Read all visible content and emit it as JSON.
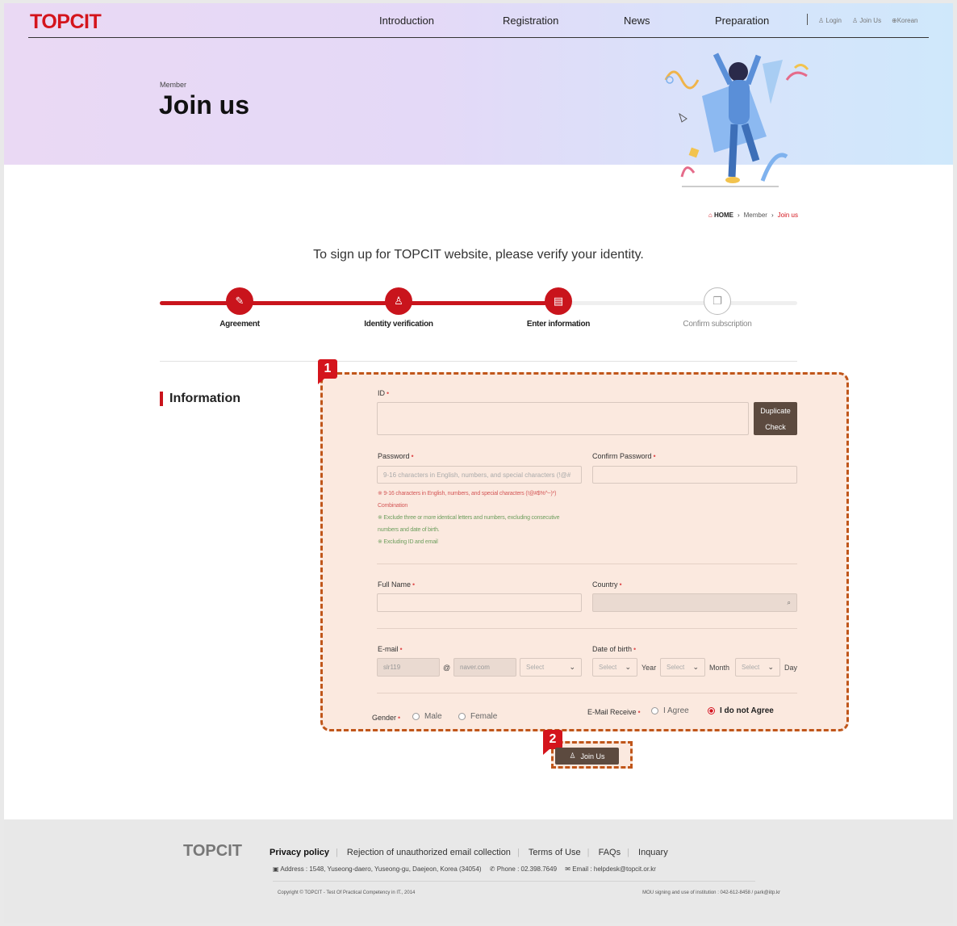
{
  "header": {
    "logo": "TOPCIT",
    "nav": [
      "Introduction",
      "Registration",
      "News",
      "Preparation"
    ],
    "util": {
      "login": "Login",
      "join": "Join Us",
      "lang": "Korean"
    },
    "member_label": "Member",
    "title": "Join us"
  },
  "breadcrumb": {
    "home": "HOME",
    "member": "Member",
    "current": "Join us"
  },
  "intro": "To sign up for TOPCIT website, please verify your identity.",
  "steps": [
    {
      "label": "Agreement",
      "icon": "pencil-icon",
      "active": true
    },
    {
      "label": "Identity verification",
      "icon": "user-icon",
      "active": true
    },
    {
      "label": "Enter information",
      "icon": "document-icon",
      "active": true
    },
    {
      "label": "Confirm subscription",
      "icon": "clipboard-icon",
      "active": false
    }
  ],
  "section_title": "Information",
  "badges": {
    "form": "1",
    "join": "2"
  },
  "form": {
    "id_label": "ID",
    "duplicate_check_line1": "Duplicate",
    "duplicate_check_line2": "Check",
    "password_label": "Password",
    "password_placeholder": "9-16 characters in English, numbers, and special characters (!@#",
    "confirm_password_label": "Confirm Password",
    "hint_1a": "※ 9-16 characters in English, numbers, and special characters (!@#$%^~)*)",
    "hint_1b": "Combination",
    "hint_2a": "※ Exclude three or more identical letters and numbers, excluding consecutive",
    "hint_2b": "numbers and date of birth.",
    "hint_3": "※ Excluding ID and email",
    "fullname_label": "Full Name",
    "country_label": "Country",
    "email_label": "E-mail",
    "email_user": "slr119",
    "email_at": "@",
    "email_domain": "naver.com",
    "email_select": "Select",
    "dob_label": "Date of birth",
    "year_select": "Select",
    "year_unit": "Year",
    "month_select": "Select",
    "month_unit": "Month",
    "day_select": "Select",
    "day_unit": "Day",
    "gender_label": "Gender",
    "gender_male": "Male",
    "gender_female": "Female",
    "email_receive_label": "E-Mail Receive",
    "agree": "I Agree",
    "disagree": "I do not Agree",
    "required_mark": "•"
  },
  "join_button": "Join Us",
  "footer": {
    "logo": "TOPCIT",
    "links": [
      "Privacy policy",
      "Rejection of unauthorized email collection",
      "Terms of Use",
      "FAQs",
      "Inquary"
    ],
    "address": "Address : 1548, Yuseong-daero, Yuseong-gu, Daejeon, Korea (34054)",
    "phone": "Phone : 02.398.7649",
    "email": "Email : helpdesk@topcit.or.kr",
    "copyright": "Copyright © TOPCIT - Test Of Practical Competency in IT., 2014",
    "mou": "MOU signing and use of institution : 042-612-8458 / park@iitp.kr"
  }
}
